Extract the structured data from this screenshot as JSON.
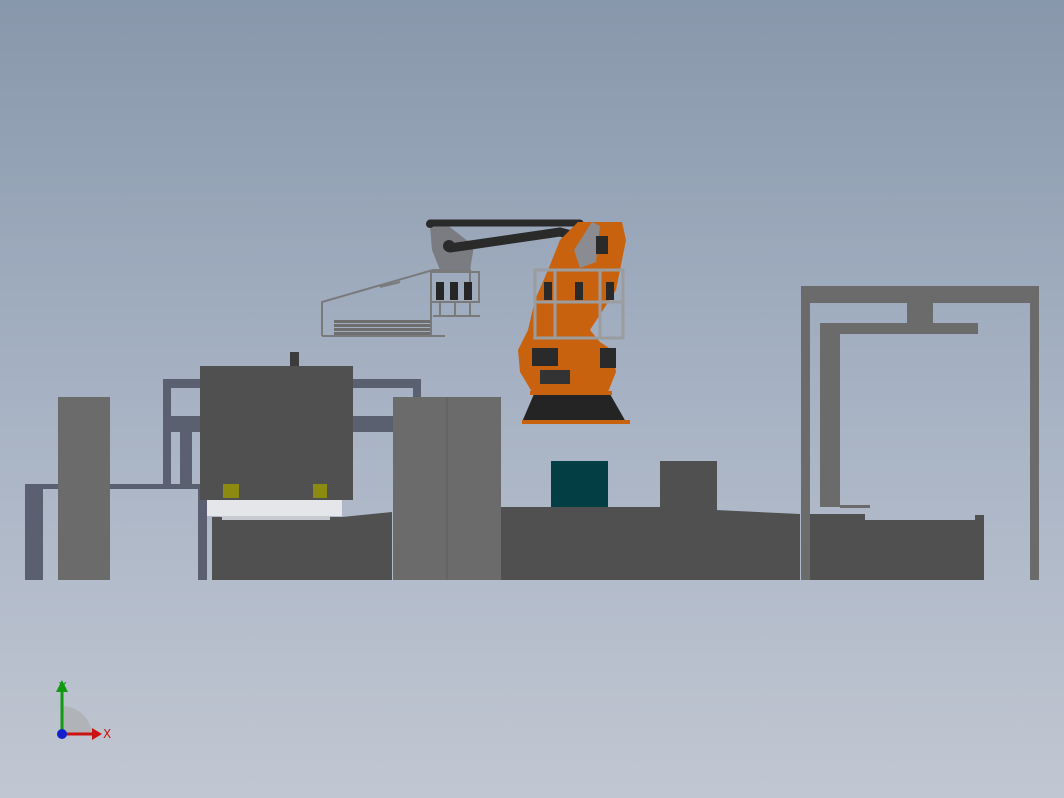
{
  "viewport": {
    "background_top": "#8897ab",
    "background_bottom": "#c1c7d2"
  },
  "colors": {
    "robot_orange": "#c9620e",
    "robot_dark": "#2a2a2a",
    "machine_dark": "#505050",
    "machine_mid": "#6b6b6b",
    "frame_grey": "#5a6070",
    "teal_box": "#033e44",
    "yellow_marker": "#8c8a10"
  },
  "triad": {
    "x_label": "X",
    "y_label": "Y",
    "x_color": "#cc1111",
    "y_color": "#119911",
    "z_color": "#1122cc"
  }
}
